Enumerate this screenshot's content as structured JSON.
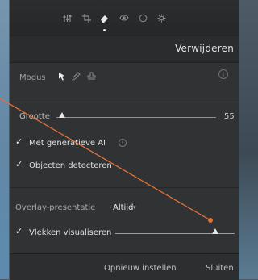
{
  "toolbar": {
    "tools": [
      "sliders-icon",
      "crop-icon",
      "eraser-icon",
      "eye-icon",
      "circle-icon",
      "gear-icon"
    ]
  },
  "header": {
    "title": "Verwijderen"
  },
  "mode": {
    "label": "Modus",
    "icons": [
      "pointer-icon",
      "pencil-icon",
      "stamp-icon"
    ]
  },
  "size": {
    "label": "Grootte",
    "value": "55",
    "level": 0.08
  },
  "options": {
    "gen_ai_label": "Met generatieve AI",
    "detect_label": "Objecten detecteren"
  },
  "overlay": {
    "label": "Overlay-presentatie",
    "value": "Altijd"
  },
  "visualize": {
    "label": "Vlekken visualiseren",
    "level": 0.92
  },
  "footer": {
    "reset_label": "Opnieuw instellen",
    "close_label": "Sluiten"
  },
  "colors": {
    "panel": "#303234",
    "accent_line": "#e0703a"
  }
}
